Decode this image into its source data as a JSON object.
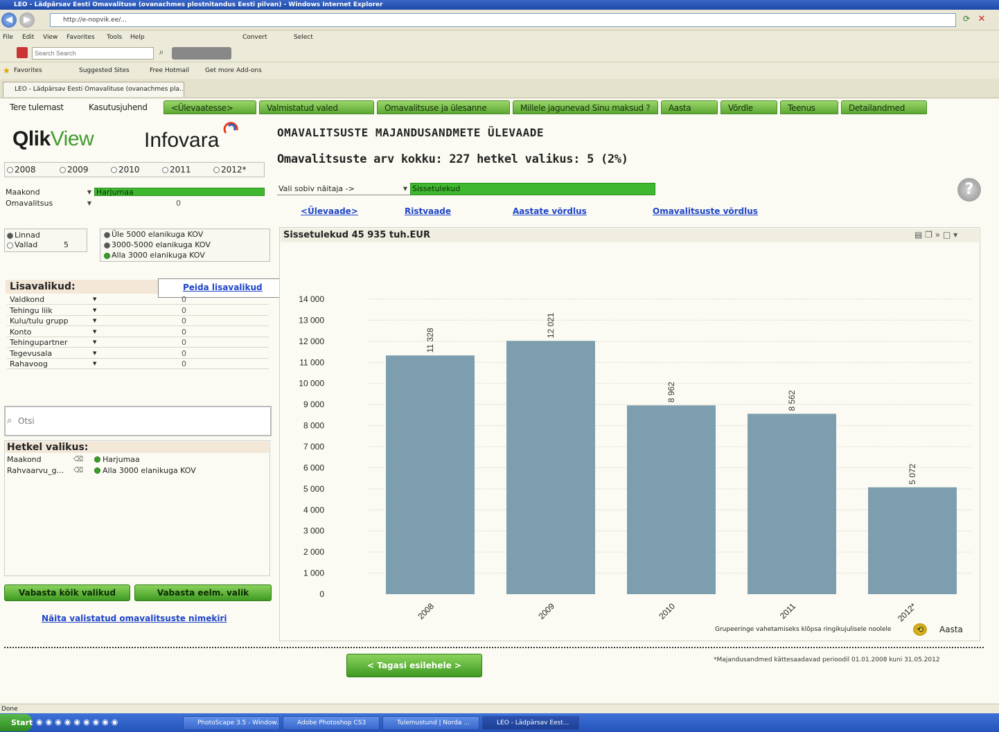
{
  "window": {
    "title": "LEO - Lädpärsav Eesti Omavalituse (ovanachmes plostnitandus Eesti pilvan) - Windows Internet Explorer",
    "address": "http://e-nopvik.ee/..."
  },
  "ie_menu": [
    "File",
    "Edit",
    "View",
    "Favorites",
    "Tools",
    "Help"
  ],
  "ie_menu_extras": [
    "Convert",
    "Select"
  ],
  "ie_search_placeholder": "Search Search",
  "favorites": {
    "label": "Favorites",
    "items": [
      "Suggested Sites",
      "Free Hotmail",
      "Get more Add-ons"
    ]
  },
  "ie_tab_title": "LEO - Lädpärsav Eesti Omavalituse (ovanachmes pla...",
  "sheet_tabs": [
    {
      "label": "Tere tulemast",
      "style": "plain"
    },
    {
      "label": "Kasutusjuhend",
      "style": "plain"
    },
    {
      "label": "<Ülevaatesse>",
      "style": "green"
    },
    {
      "label": "Valmistatud valed",
      "style": "green"
    },
    {
      "label": "Omavalitsuse ja ülesanne",
      "style": "green"
    },
    {
      "label": "Millele jagunevad Sinu maksud ?",
      "style": "green"
    },
    {
      "label": "Aasta",
      "style": "green"
    },
    {
      "label": "Võrdle",
      "style": "green"
    },
    {
      "label": "Teenus",
      "style": "green"
    },
    {
      "label": "Detailandmed",
      "style": "green"
    }
  ],
  "logo": {
    "qlik": "Qlik",
    "view": "View",
    "infovara": "Infovara"
  },
  "years": [
    {
      "label": "2008",
      "selected": false
    },
    {
      "label": "2009",
      "selected": false
    },
    {
      "label": "2010",
      "selected": false
    },
    {
      "label": "2011",
      "selected": false
    },
    {
      "label": "2012*",
      "selected": false
    }
  ],
  "filters": {
    "maakond_label": "Maakond",
    "maakond_value": "Harjumaa",
    "omavalitsus_label": "Omavalitsus",
    "omavalitsus_value": "0"
  },
  "kov_type": {
    "linnad_label": "Linnad",
    "vallad_label": "Vallad",
    "vallad_count": "5",
    "size_options": [
      "Üle 5000 elanikuga KOV",
      "3000-5000 elanikuga KOV",
      "Alla 3000 elanikuga KOV"
    ]
  },
  "lisavalikud": {
    "title": "Lisavalikud:",
    "link": "Peida lisavalikud",
    "rows": [
      {
        "name": "Valdkond",
        "value": "0"
      },
      {
        "name": "Tehingu liik",
        "value": "0"
      },
      {
        "name": "Kulu/tulu grupp",
        "value": "0"
      },
      {
        "name": "Konto",
        "value": "0"
      },
      {
        "name": "Tehingupartner",
        "value": "0"
      },
      {
        "name": "Tegevusala",
        "value": "0"
      },
      {
        "name": "Rahavoog",
        "value": "0"
      }
    ]
  },
  "search": {
    "placeholder": "Otsi"
  },
  "current_selection": {
    "title": "Hetkel valikus:",
    "rows": [
      {
        "field": "Maakond",
        "value": "Harjumaa"
      },
      {
        "field": "Rahvaarvu_g...",
        "value": "Alla 3000 elanikuga KOV"
      }
    ]
  },
  "buttons": {
    "clear_all": "Vabasta kõik valikud",
    "clear_prev": "Vabasta eelm. valik",
    "show_list": "Näita valistatud omavalitsuste nimekiri",
    "next_step": "< Tagasi esilehele >"
  },
  "main": {
    "title": "OMAVALITSUSTE MAJANDUSANDMETE ÜLEVAADE",
    "count_text": "Omavalitsuste arv kokku: 227 hetkel valikus: 5 (2%)",
    "indicator_select": "Vali sobiv näitaja ->",
    "indicator_value": "Sissetulekud",
    "links": [
      "<Ülevaade>",
      "Ristvaade",
      "Aastate võrdlus",
      "Omavalitsuste võrdlus"
    ],
    "help": "?"
  },
  "chart": {
    "caption": "Sissetulekud 45 935 tuh.EUR",
    "footer_note": "Grupeeringe vahetamiseks klõpsa ringikujulisele noolele",
    "dimension_label": "Aasta",
    "footnote": "*Majandusandmed kättesaadavad perioodil 01.01.2008 kuni 31.05.2012"
  },
  "chart_data": {
    "type": "bar",
    "title": "Sissetulekud 45 935 tuh.EUR",
    "xlabel": "Aasta",
    "ylabel": "",
    "categories": [
      "2008",
      "2009",
      "2010",
      "2011",
      "2012*"
    ],
    "values": [
      11328,
      12021,
      8962,
      8562,
      5072
    ],
    "value_labels": [
      "11 328",
      "12 021",
      "8 962",
      "8 562",
      "5 072"
    ],
    "ylim": [
      0,
      14000
    ],
    "yticks": [
      "0",
      "1 000",
      "2 000",
      "3 000",
      "4 000",
      "5 000",
      "6 000",
      "7 000",
      "8 000",
      "9 000",
      "10 000",
      "11 000",
      "12 000",
      "13 000",
      "14 000"
    ],
    "bar_color": "#7d9eae",
    "grid": true
  },
  "statusbar": {
    "text": "Done"
  },
  "taskbar": {
    "start": "Start",
    "items": [
      "PhotoScape 3.5 - Window...",
      "Adobe Photoshop CS3",
      "Tulemustund | Norda ...",
      "LEO - Lädpärsav Eest..."
    ]
  }
}
